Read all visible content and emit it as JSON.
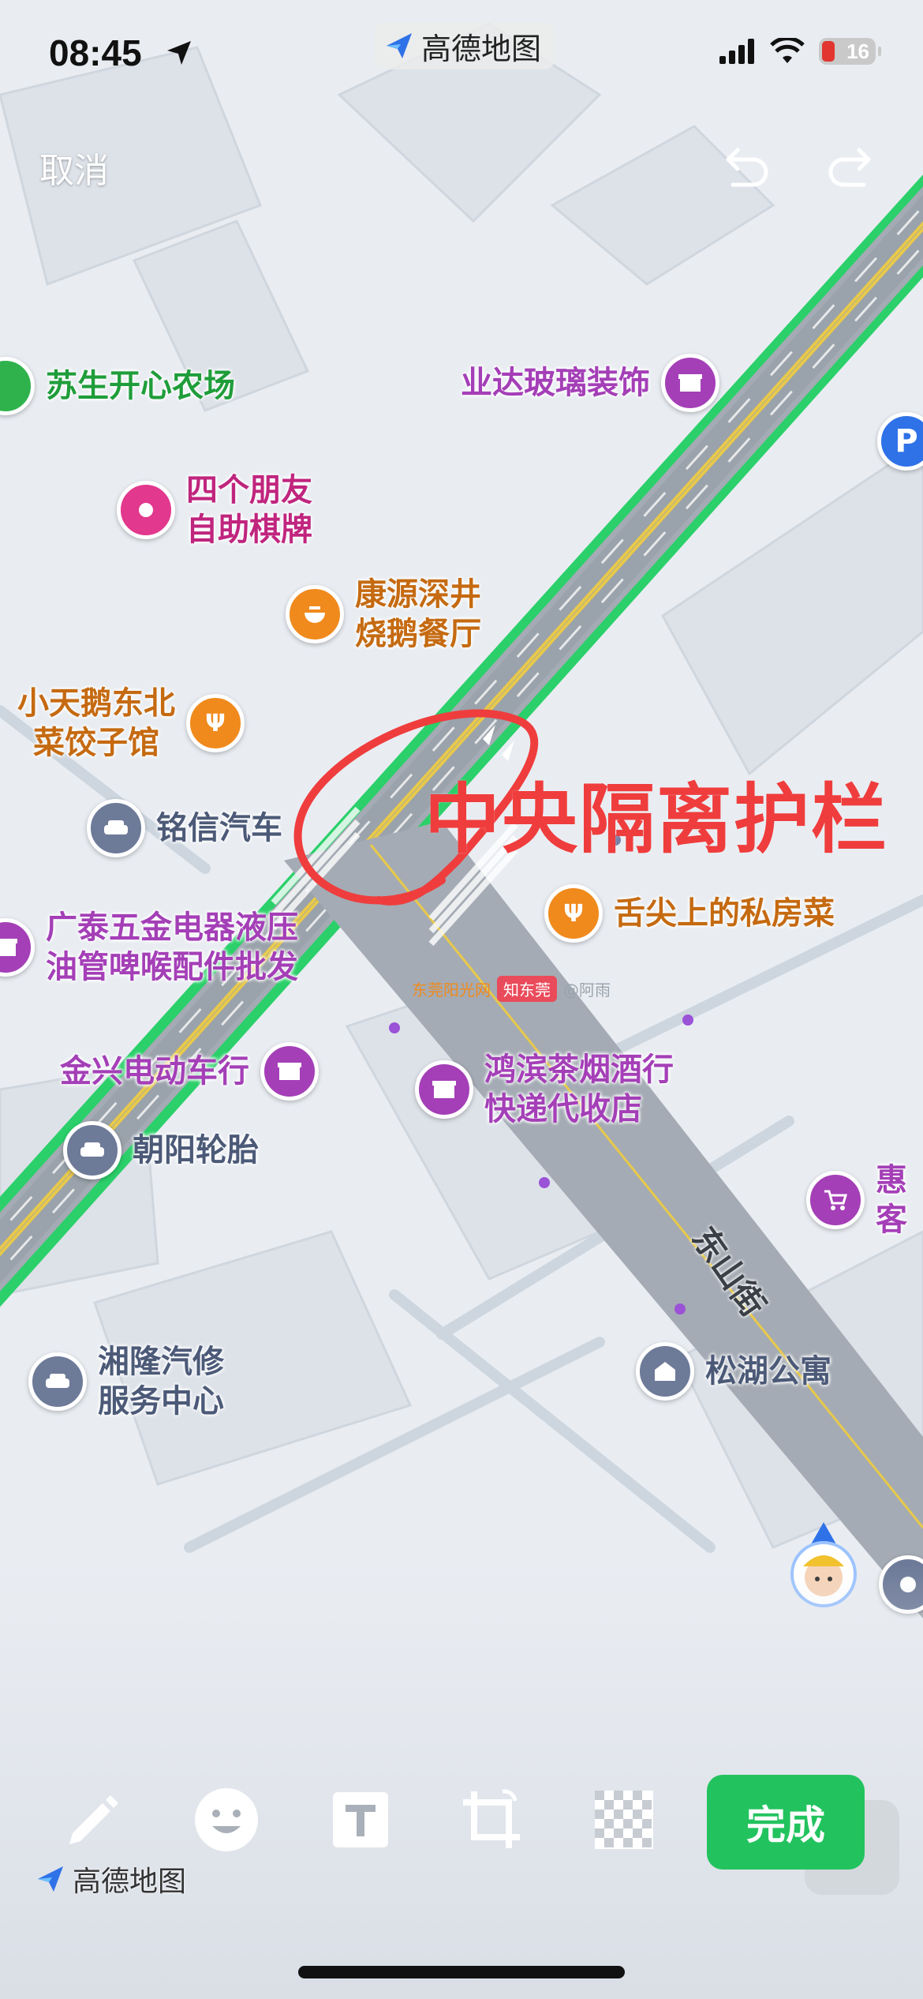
{
  "status_bar": {
    "time": "08:45",
    "battery": "16",
    "app_badge": "高德地图"
  },
  "editor": {
    "cancel_label": "取消",
    "done_label": "完成",
    "annotation_text": "中央隔离护栏",
    "colors": {
      "annotation": "#ef3d3d",
      "done": "#22c35e",
      "road_edge": "#2bd06a"
    },
    "tools": [
      "pencil-icon",
      "emoji-icon",
      "text-icon",
      "crop-icon",
      "mosaic-icon"
    ]
  },
  "map": {
    "street_name": "东山街",
    "logo_text": "高德地图",
    "watermark": {
      "source1": "东莞阳光网",
      "source2": "知东莞",
      "source3": "@阿雨"
    },
    "pois": [
      {
        "label": "苏生开心农场",
        "type": "farm",
        "color": "#1f9d3a"
      },
      {
        "label": "业达玻璃装饰",
        "type": "shop",
        "color": "#a43fb7"
      },
      {
        "label": "四个朋友\n自助棋牌",
        "type": "leisure",
        "color": "#c0257e"
      },
      {
        "label": "康源深井\n烧鹅餐厅",
        "type": "restaurant",
        "color": "#c56a11"
      },
      {
        "label": "小天鹅东北\n菜饺子馆",
        "type": "restaurant",
        "color": "#c56a11"
      },
      {
        "label": "铭信汽车",
        "type": "car",
        "color": "#4c5a78"
      },
      {
        "label": "舌尖上的私房菜",
        "type": "restaurant",
        "color": "#c56a11"
      },
      {
        "label": "广泰五金电器液压\n油管啤喉配件批发",
        "type": "shop",
        "color": "#a43fb7"
      },
      {
        "label": "金兴电动车行",
        "type": "shop",
        "color": "#a43fb7"
      },
      {
        "label": "鸿滨茶烟酒行\n快递代收店",
        "type": "shop",
        "color": "#a43fb7"
      },
      {
        "label": "朝阳轮胎",
        "type": "car",
        "color": "#4c5a78"
      },
      {
        "label": "惠客",
        "type": "supermarket",
        "color": "#a43fb7"
      },
      {
        "label": "湘隆汽修\n服务中心",
        "type": "car",
        "color": "#4c5a78"
      },
      {
        "label": "松湖公寓",
        "type": "apartment",
        "color": "#4c5a78"
      }
    ]
  }
}
